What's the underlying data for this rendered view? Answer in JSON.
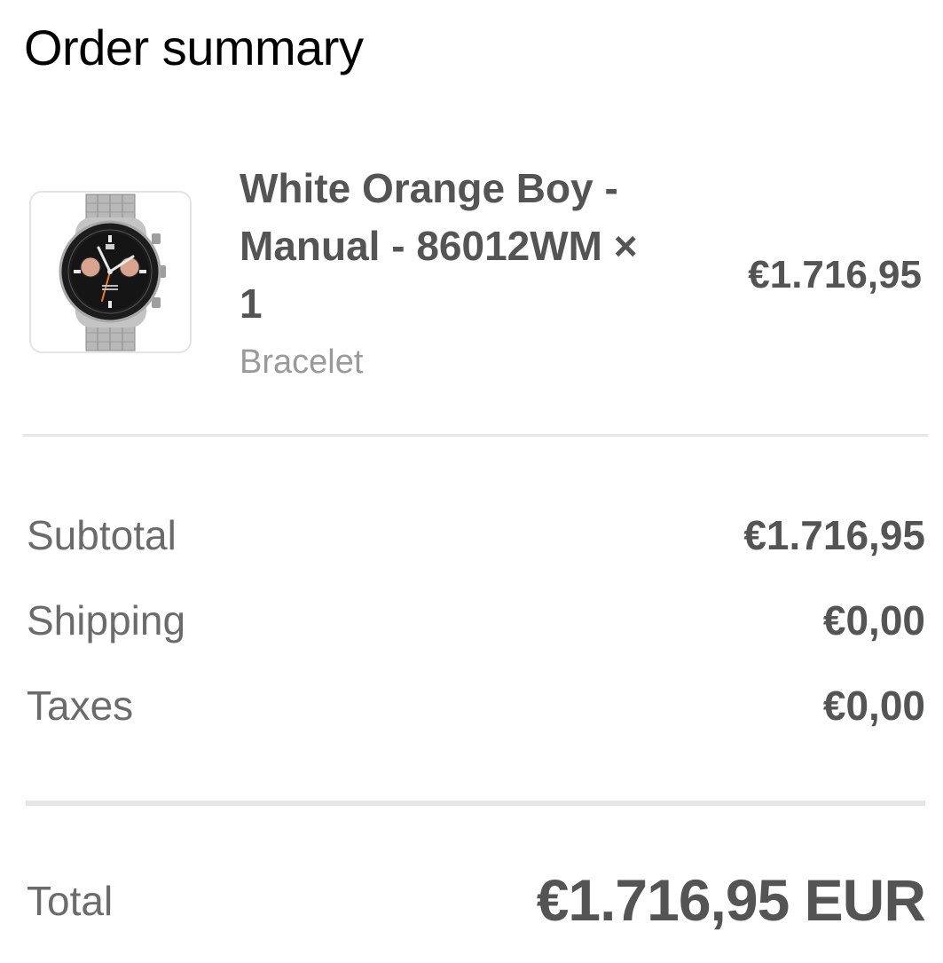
{
  "page": {
    "title": "Order summary"
  },
  "line_item": {
    "title": "White Orange Boy - Manual - 86012WM × 1",
    "variant": "Bracelet",
    "price": "€1.716,95",
    "image": "product-thumbnail-watch"
  },
  "summary": {
    "subtotal": {
      "label": "Subtotal",
      "value": "€1.716,95"
    },
    "shipping": {
      "label": "Shipping",
      "value": "€0,00"
    },
    "taxes": {
      "label": "Taxes",
      "value": "€0,00"
    }
  },
  "total": {
    "label": "Total",
    "value": "€1.716,95 EUR"
  },
  "colors": {
    "text_primary": "#000000",
    "text_strong": "#545454",
    "text_muted": "#9a9a9a",
    "divider": "#e6e6e6"
  }
}
